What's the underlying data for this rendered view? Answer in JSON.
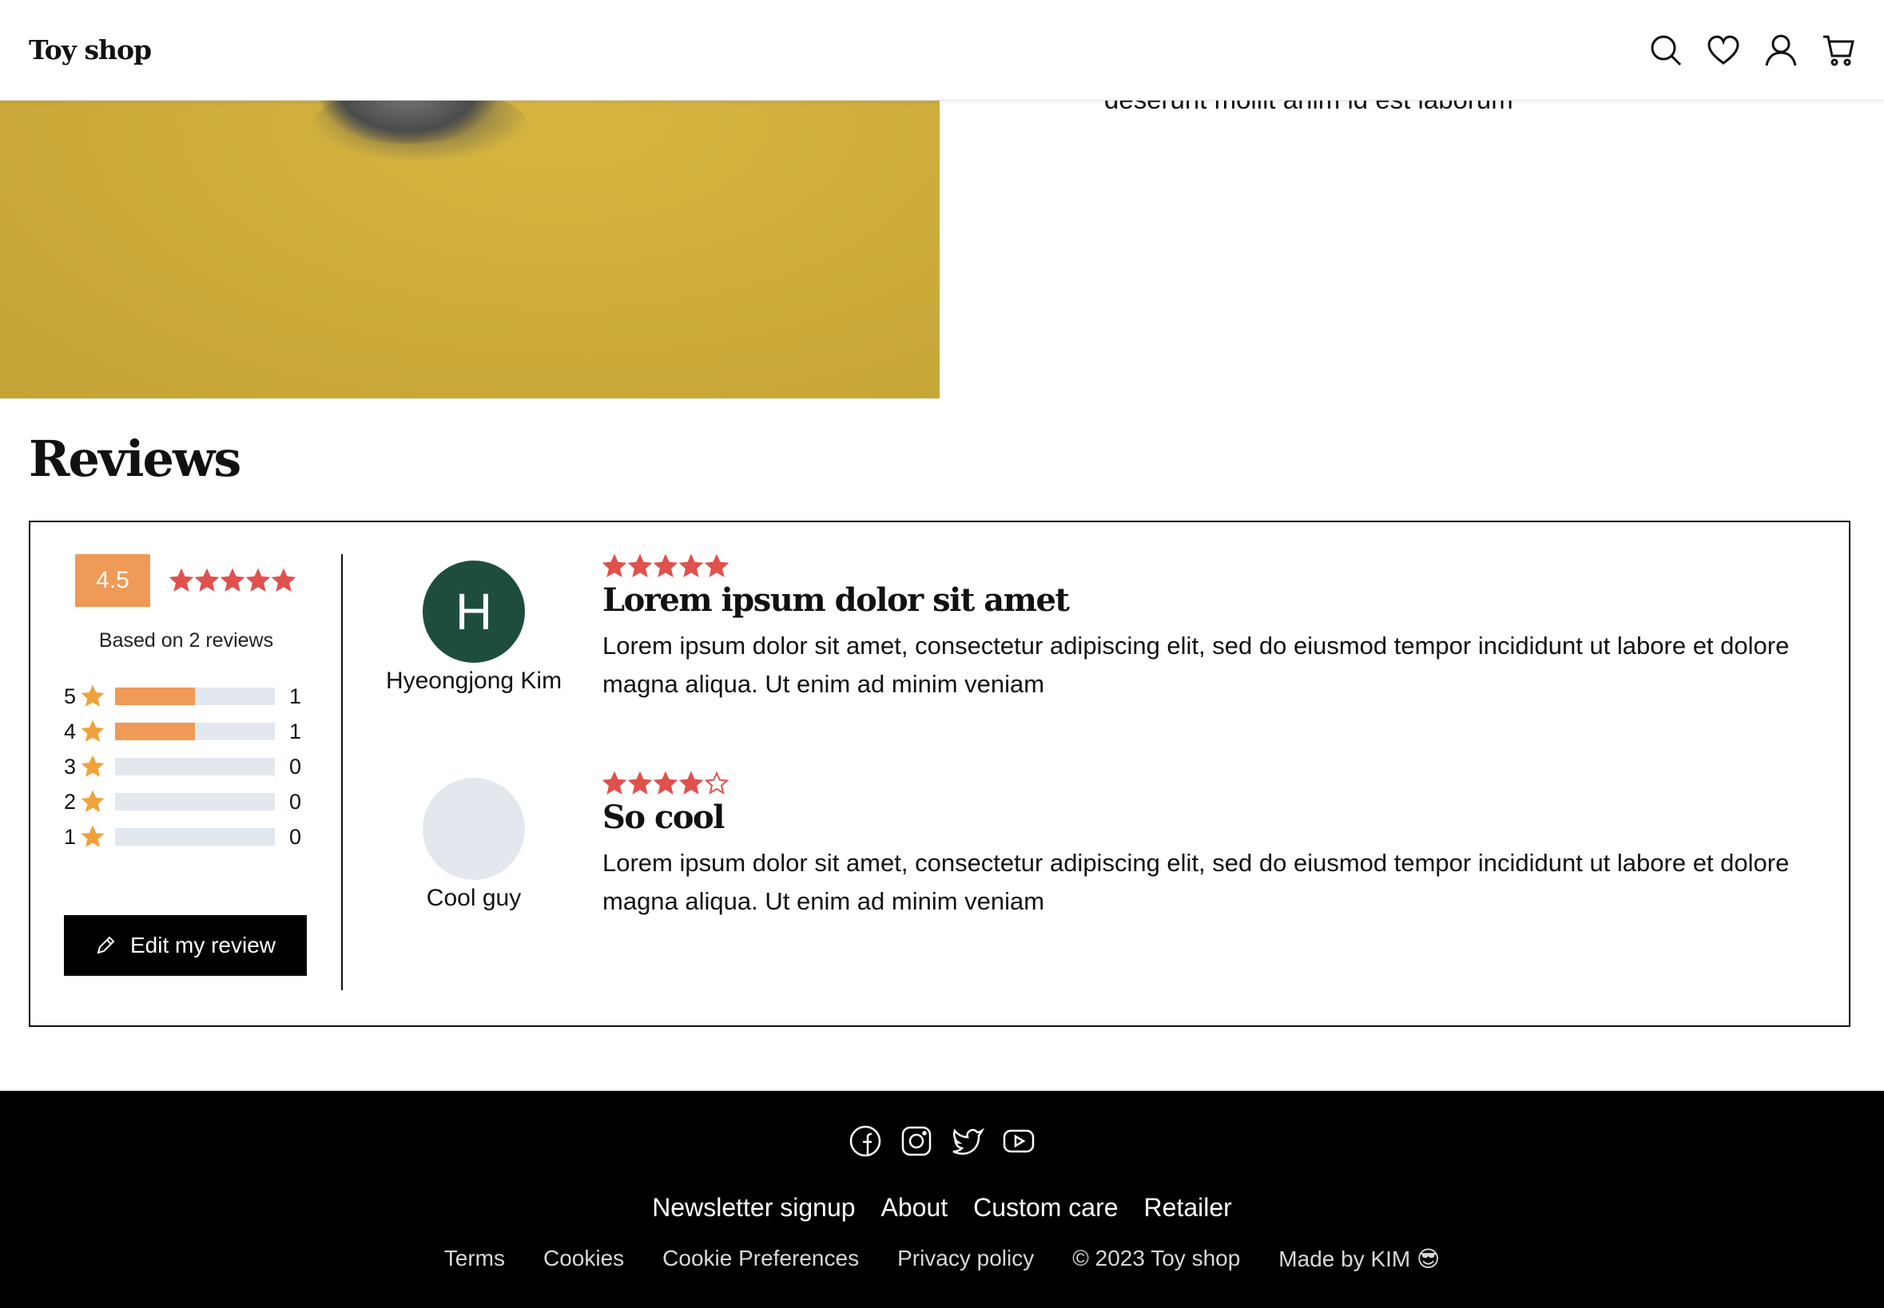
{
  "header": {
    "logo": "Toy shop",
    "icons": [
      "search-icon",
      "heart-icon",
      "user-icon",
      "cart-icon"
    ]
  },
  "product": {
    "description_tail": "deserunt mollit anim id est laborum"
  },
  "reviews": {
    "title": "Reviews",
    "average": "4.5",
    "average_stars": 5,
    "based_on": "Based on 2 reviews",
    "distribution": [
      {
        "rating": "5",
        "count": "1",
        "fraction": 0.5
      },
      {
        "rating": "4",
        "count": "1",
        "fraction": 0.5
      },
      {
        "rating": "3",
        "count": "0",
        "fraction": 0
      },
      {
        "rating": "2",
        "count": "0",
        "fraction": 0
      },
      {
        "rating": "1",
        "count": "0",
        "fraction": 0
      }
    ],
    "edit_button": "Edit my review",
    "items": [
      {
        "initial": "H",
        "author": "Hyeongjong Kim",
        "avatar_color": "#1e4d40",
        "stars": 5,
        "title": "Lorem ipsum dolor sit amet",
        "text": "Lorem ipsum dolor sit amet, consectetur adipiscing elit, sed do eiusmod tempor incididunt ut labore et dolore magna aliqua. Ut enim ad minim veniam"
      },
      {
        "initial": "",
        "author": "Cool guy",
        "avatar_color": "#e3e8ef",
        "stars": 4,
        "title": "So cool",
        "text": "Lorem ipsum dolor sit amet, consectetur adipiscing elit, sed do eiusmod tempor incididunt ut labore et dolore magna aliqua. Ut enim ad minim veniam"
      }
    ]
  },
  "footer": {
    "social_icons": [
      "facebook-icon",
      "instagram-icon",
      "twitter-icon",
      "youtube-icon"
    ],
    "links": [
      "Newsletter signup",
      "About",
      "Custom care",
      "Retailer"
    ],
    "legal": [
      "Terms",
      "Cookies",
      "Cookie Preferences",
      "Privacy policy",
      "© 2023 Toy shop",
      "Made by KIM 😎"
    ]
  },
  "colors": {
    "accent_orange": "#ef9a56",
    "star_red": "#e0504d",
    "mini_star": "#f0a23a",
    "bar_bg": "#e3e8ef"
  }
}
